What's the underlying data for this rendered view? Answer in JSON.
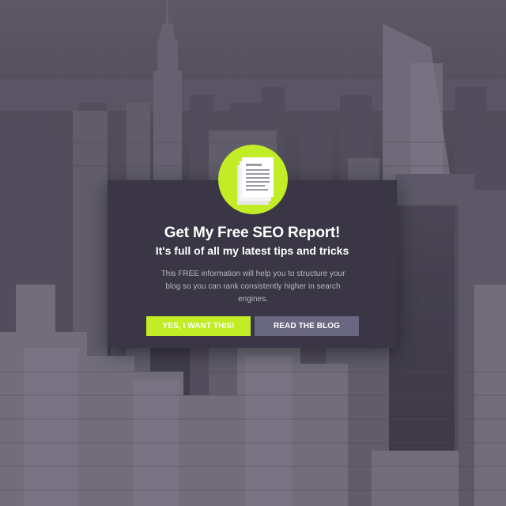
{
  "modal": {
    "title": "Get My Free SEO Report!",
    "subtitle": "It's full of all my latest tips and tricks",
    "body": "This FREE information will help you to structure your blog so you can rank consistently higher in search engines.",
    "primary_button": "YES, I WANT THIS!",
    "secondary_button": "READ THE BLOG",
    "badge_icon": "document-stack-icon"
  },
  "colors": {
    "accent": "#c1ec26",
    "modal_background": "#3a3645",
    "secondary_button": "#6a6780"
  }
}
